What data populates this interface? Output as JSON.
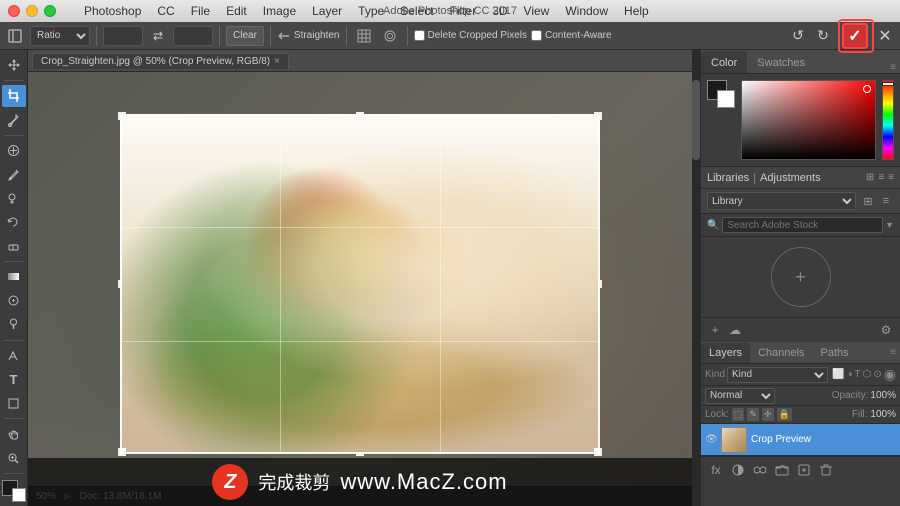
{
  "titlebar": {
    "title": "Adobe Photoshop CC 2017",
    "traffic_lights": [
      "close",
      "minimize",
      "maximize"
    ]
  },
  "menubar": {
    "items": [
      "Photoshop",
      "CC",
      "File",
      "Edit",
      "Image",
      "Layer",
      "Type",
      "Select",
      "Filter",
      "3D",
      "View",
      "Window",
      "Help"
    ]
  },
  "options_bar": {
    "ratio_label": "Ratio",
    "clear_label": "Clear",
    "straighten_label": "Straighten",
    "delete_cropped_label": "Delete Cropped Pixels",
    "content_aware_label": "Content-Aware",
    "swap_icon": "⇄",
    "grid_icon": "⊞",
    "settings_icon": "⚙",
    "undo_icon": "↺",
    "redo_icon": "↻",
    "commit_check": "✓",
    "cancel_x": "✕"
  },
  "file_tab": {
    "name": "Crop_Straighten.jpg @ 50% (Crop Preview, RGB/8)",
    "close": "×"
  },
  "canvas": {
    "background_color": "#5a5a5a"
  },
  "status_bar": {
    "zoom": "50%",
    "doc_size": "Doc: 13.8M/18.1M"
  },
  "color_panel": {
    "tabs": [
      "Color",
      "Swatches"
    ],
    "active_tab": "Color",
    "fg_color": "#1a1a1a",
    "bg_color": "#ffffff"
  },
  "libraries_panel": {
    "title": "Libraries",
    "subtitle": "Adjustments",
    "library_label": "Library",
    "search_placeholder": "Search Adobe Stock",
    "plus_icon": "+",
    "view_grid_icon": "⊞",
    "view_list_icon": "≡"
  },
  "layers_panel": {
    "tabs": [
      "Layers",
      "Channels",
      "Paths"
    ],
    "active_tab": "Layers",
    "kind_label": "Kind",
    "blend_mode": "Normal",
    "opacity_label": "Opacity:",
    "opacity_value": "100%",
    "lock_label": "Lock:",
    "fill_label": "Fill:",
    "fill_value": "100%",
    "layers": [
      {
        "name": "Crop Preview",
        "visible": true,
        "selected": true
      }
    ],
    "footer_icons": [
      "fx",
      "circle-half",
      "folder",
      "page",
      "trash"
    ]
  },
  "watermark": {
    "logo_letter": "Z",
    "text": "www.MacZ.com",
    "cn_text": "完成裁剪"
  },
  "commit_button": {
    "highlight_color": "#cc3333"
  }
}
